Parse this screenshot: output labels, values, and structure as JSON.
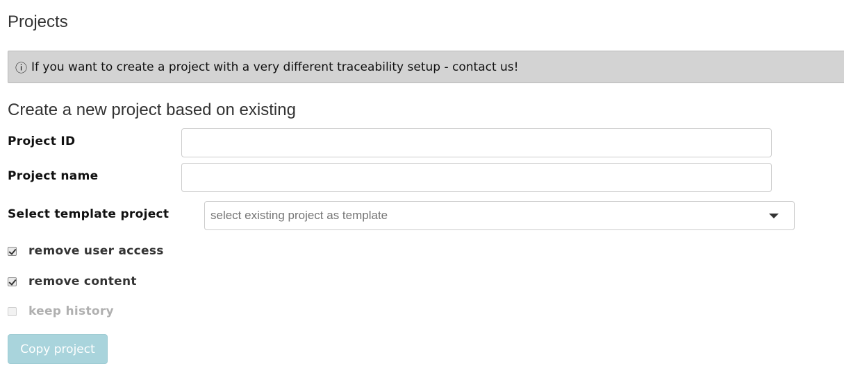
{
  "page": {
    "title": "Projects"
  },
  "info": {
    "icon": "info-circle-icon",
    "glyph": "ⓘ",
    "message": "If you want to create a project with a very different traceability setup - contact us!"
  },
  "form": {
    "section_title": "Create a new project based on existing",
    "project_id": {
      "label": "Project ID",
      "value": "",
      "placeholder": ""
    },
    "project_name": {
      "label": "Project name",
      "value": "",
      "placeholder": ""
    },
    "template": {
      "label": "Select template project",
      "placeholder": "select existing project as template",
      "value": ""
    },
    "options": [
      {
        "label": "remove user access",
        "checked": true,
        "disabled": false
      },
      {
        "label": "remove content",
        "checked": true,
        "disabled": false
      },
      {
        "label": "keep history",
        "checked": false,
        "disabled": true
      }
    ],
    "submit_label": "Copy project",
    "submit_color": "#a9d4dc"
  }
}
